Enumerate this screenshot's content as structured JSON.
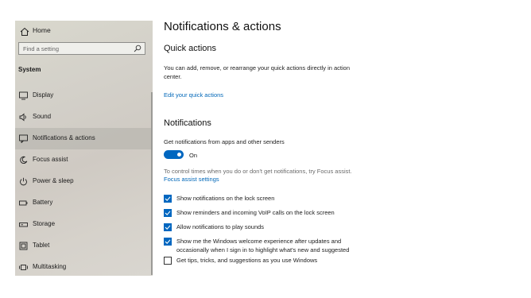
{
  "sidebar": {
    "home_label": "Home",
    "search_placeholder": "Find a setting",
    "section_title": "System",
    "items": [
      {
        "label": "Display",
        "icon": "display-icon"
      },
      {
        "label": "Sound",
        "icon": "sound-icon"
      },
      {
        "label": "Notifications & actions",
        "icon": "notifications-icon",
        "active": true
      },
      {
        "label": "Focus assist",
        "icon": "focus-assist-icon"
      },
      {
        "label": "Power & sleep",
        "icon": "power-icon"
      },
      {
        "label": "Battery",
        "icon": "battery-icon"
      },
      {
        "label": "Storage",
        "icon": "storage-icon"
      },
      {
        "label": "Tablet",
        "icon": "tablet-icon"
      },
      {
        "label": "Multitasking",
        "icon": "multitasking-icon"
      }
    ]
  },
  "main": {
    "title": "Notifications & actions",
    "quick_actions": {
      "heading": "Quick actions",
      "description_line1": "You can add, remove, or rearrange your quick actions directly in action",
      "description_line2": "center.",
      "edit_link": "Edit your quick actions"
    },
    "notifications": {
      "heading": "Notifications",
      "toggle_caption": "Get notifications from apps and other senders",
      "toggle_state": "On",
      "focus_hint": "To control times when you do or don't get notifications, try Focus assist.",
      "focus_link": "Focus assist settings",
      "checkboxes": [
        {
          "label": "Show notifications on the lock screen",
          "checked": true
        },
        {
          "label": "Show reminders and incoming VoIP calls on the lock screen",
          "checked": true
        },
        {
          "label": "Allow notifications to play sounds",
          "checked": true
        },
        {
          "label_line1": "Show me the Windows welcome experience after updates and",
          "label_line2": "occasionally when I sign in to highlight what's new and suggested",
          "checked": true
        },
        {
          "label": "Get tips, tricks, and suggestions as you use Windows",
          "checked": false
        }
      ]
    }
  },
  "colors": {
    "accent": "#0067c0",
    "link": "#0067b8"
  }
}
